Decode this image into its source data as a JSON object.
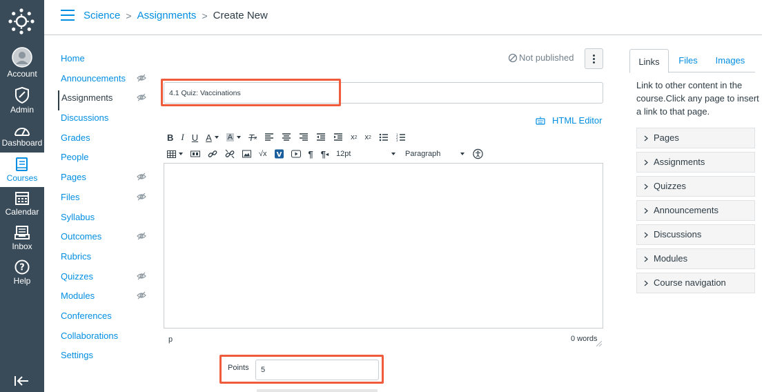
{
  "global_nav": {
    "items": [
      {
        "label": "Account",
        "icon": "account-icon"
      },
      {
        "label": "Admin",
        "icon": "admin-shield-icon"
      },
      {
        "label": "Dashboard",
        "icon": "dashboard-gauge-icon"
      },
      {
        "label": "Courses",
        "icon": "courses-book-icon",
        "active": true
      },
      {
        "label": "Calendar",
        "icon": "calendar-icon"
      },
      {
        "label": "Inbox",
        "icon": "inbox-icon"
      },
      {
        "label": "Help",
        "icon": "help-icon"
      }
    ]
  },
  "breadcrumb": {
    "course": "Science",
    "section": "Assignments",
    "current": "Create New",
    "separator": ">"
  },
  "course_nav": {
    "items": [
      {
        "label": "Home",
        "hidden_eye": false
      },
      {
        "label": "Announcements",
        "hidden_eye": true
      },
      {
        "label": "Assignments",
        "hidden_eye": true,
        "active": true
      },
      {
        "label": "Discussions",
        "hidden_eye": false
      },
      {
        "label": "Grades",
        "hidden_eye": false
      },
      {
        "label": "People",
        "hidden_eye": false
      },
      {
        "label": "Pages",
        "hidden_eye": true
      },
      {
        "label": "Files",
        "hidden_eye": true
      },
      {
        "label": "Syllabus",
        "hidden_eye": false
      },
      {
        "label": "Outcomes",
        "hidden_eye": true
      },
      {
        "label": "Rubrics",
        "hidden_eye": false
      },
      {
        "label": "Quizzes",
        "hidden_eye": true
      },
      {
        "label": "Modules",
        "hidden_eye": true
      },
      {
        "label": "Conferences",
        "hidden_eye": false
      },
      {
        "label": "Collaborations",
        "hidden_eye": false
      },
      {
        "label": "Settings",
        "hidden_eye": false
      }
    ]
  },
  "publish_status": "Not published",
  "assignment": {
    "title_value": "4.1 Quiz: Vaccinations",
    "points_label": "Points",
    "points_value": "5"
  },
  "editor": {
    "html_editor_link": "HTML Editor",
    "font_size": "12pt",
    "block_format": "Paragraph",
    "path_indicator": "p",
    "word_count": "0 words",
    "toolbar_row1": [
      "bold",
      "italic",
      "underline",
      "text-color",
      "background-color",
      "clear-formatting",
      "align-left",
      "align-center",
      "align-right",
      "outdent",
      "indent",
      "superscript",
      "subscript",
      "bullet-list",
      "numbered-list"
    ],
    "toolbar_row2": [
      "table",
      "media",
      "link",
      "unlink",
      "image",
      "equation",
      "vimeo",
      "youtube",
      "ltr-paragraph",
      "rtl-paragraph"
    ]
  },
  "sidebar": {
    "tabs": [
      "Links",
      "Files",
      "Images"
    ],
    "active_tab": "Links",
    "description": "Link to other content in the course.Click any page to insert a link to that page.",
    "items": [
      "Pages",
      "Assignments",
      "Quizzes",
      "Announcements",
      "Discussions",
      "Modules",
      "Course navigation"
    ]
  },
  "colors": {
    "nav_bg": "#394b58",
    "link": "#008ee2",
    "text": "#2d3b45",
    "highlight": "#ef5b3b"
  }
}
